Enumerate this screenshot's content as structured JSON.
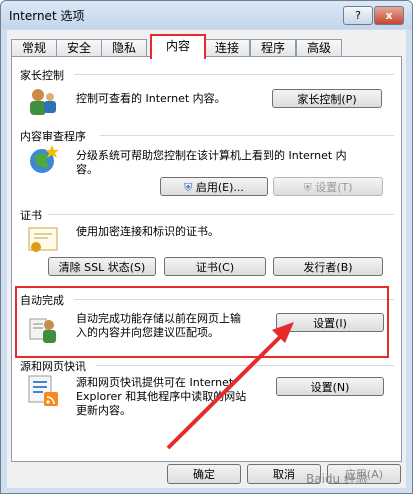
{
  "window": {
    "title": "Internet 选项",
    "help_label": "?",
    "close_label": "x"
  },
  "tabs": [
    "常规",
    "安全",
    "隐私",
    "内容",
    "连接",
    "程序",
    "高级"
  ],
  "parental": {
    "title": "家长控制",
    "desc": "控制可查看的 Internet 内容。",
    "button": "家长控制(P)"
  },
  "advisor": {
    "title": "内容审查程序",
    "desc1": "分级系统可帮助您控制在该计算机上看到的 Internet 内",
    "desc2": "容。",
    "enable_button": "启用(E)...",
    "settings_button": "设置(T)"
  },
  "certificates": {
    "title": "证书",
    "desc": "使用加密连接和标识的证书。",
    "clear_ssl_button": "清除 SSL 状态(S)",
    "certs_button": "证书(C)",
    "publishers_button": "发行者(B)"
  },
  "autocomplete": {
    "title": "自动完成",
    "desc1": "自动完成功能存储以前在网页上输",
    "desc2": "入的内容并向您建议匹配项。",
    "settings_button": "设置(I)"
  },
  "feeds": {
    "title": "源和网页快讯",
    "desc1": "源和网页快讯提供可在 Internet",
    "desc2": "Explorer 和其他程序中读取的网站",
    "desc3": "更新内容。",
    "settings_button": "设置(N)"
  },
  "footer": {
    "ok": "确定",
    "cancel": "取消",
    "apply": "应用(A)"
  },
  "watermark": "Baidu 经验",
  "colors": {
    "highlight": "#e52b2b",
    "titlebar": "#c3d6ec"
  }
}
